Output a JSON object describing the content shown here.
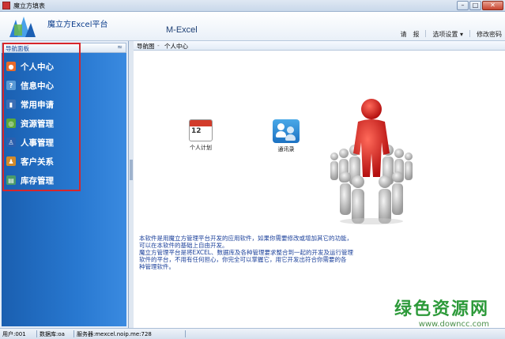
{
  "window": {
    "title": "魔立方填表",
    "controls": [
      "–",
      "□",
      "✕"
    ]
  },
  "header": {
    "app_name": "魔立方Excel平台",
    "product_name": "M-Excel",
    "links": [
      "请",
      "报",
      "选项设置 ▾",
      "修改密码"
    ]
  },
  "sidebar": {
    "panel_title": "导航面板",
    "collapse_glyph": "≈",
    "items": [
      {
        "label": "个人中心",
        "icon": "person-icon",
        "color": "#e86a2a"
      },
      {
        "label": "信息中心",
        "icon": "question-icon",
        "color": "#5a9ad5"
      },
      {
        "label": "常用申请",
        "icon": "bar-chart-icon",
        "color": "#3c6fb5"
      },
      {
        "label": "资源管理",
        "icon": "resource-icon",
        "color": "#5aa83a"
      },
      {
        "label": "人事管理",
        "icon": "user-icon",
        "color": "#2b5fae"
      },
      {
        "label": "客户关系",
        "icon": "people-icon",
        "color": "#d28a2a"
      },
      {
        "label": "库存管理",
        "icon": "inventory-icon",
        "color": "#4a9a6a"
      }
    ]
  },
  "breadcrumb": {
    "root": "导航图",
    "current": "个人中心"
  },
  "tiles": [
    {
      "label": "个人计划",
      "icon": "calendar-icon",
      "number": "12"
    },
    {
      "label": "通讯录",
      "icon": "contacts-icon"
    }
  ],
  "info_text": [
    "本软件是用魔立方管理平台开发的应用软件，如果你需要修改或增加其它的功能，",
    "可以在本软件的基础上自由开发。",
    "魔立方管理平台是将EXCEL、数据库及各种管理要求整合到一起的开发及运行管理",
    "软件的平台，不用有任何担心，你完全可以掌握它，用它开发出符合你需要的各",
    "种管理软件。"
  ],
  "status": {
    "user": "用户:001",
    "database": "数据库:oa",
    "server": "服务器:mexcel.noip.me:728"
  },
  "watermark": {
    "brand": "绿色资源网",
    "url": "www.downcc.com"
  },
  "colors": {
    "nav_bg": "#2878d0",
    "highlight": "#d7262b",
    "info_text": "#1a3f9a",
    "figure_red": "#d51e1e"
  }
}
